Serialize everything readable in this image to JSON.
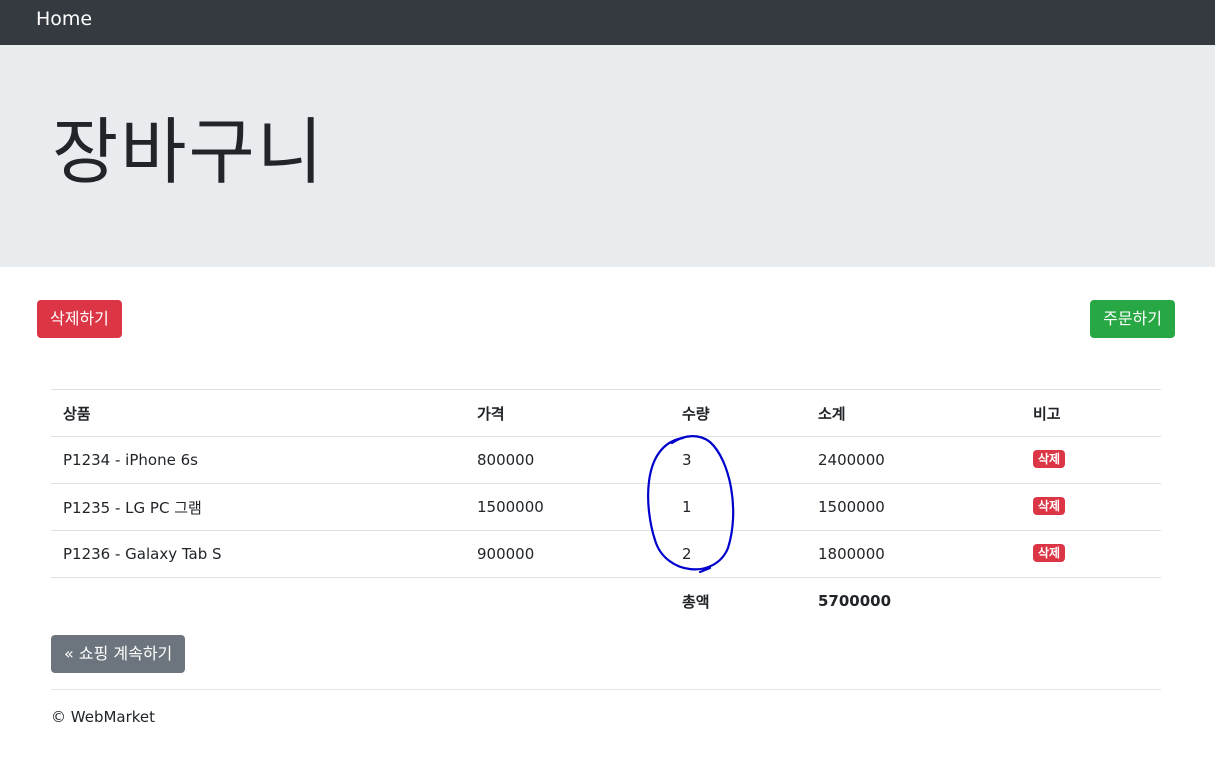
{
  "navbar": {
    "brand": "Home"
  },
  "jumbotron": {
    "title": "장바구니"
  },
  "actions": {
    "delete_label": "삭제하기",
    "order_label": "주문하기"
  },
  "cart": {
    "headers": [
      "상품",
      "가격",
      "수량",
      "소계",
      "비고"
    ],
    "rows": [
      {
        "product": "P1234 - iPhone 6s",
        "price": "800000",
        "quantity": "3",
        "subtotal": "2400000",
        "action": "삭제"
      },
      {
        "product": "P1235 - LG PC 그램",
        "price": "1500000",
        "quantity": "1",
        "subtotal": "1500000",
        "action": "삭제"
      },
      {
        "product": "P1236 - Galaxy Tab S",
        "price": "900000",
        "quantity": "2",
        "subtotal": "1800000",
        "action": "삭제"
      }
    ],
    "total_label": "총액",
    "total_value": "5700000"
  },
  "continue_label": "« 쇼핑 계속하기",
  "footer": {
    "text": "© WebMarket"
  },
  "colors": {
    "danger": "#dc3545",
    "success": "#28a745",
    "secondary": "#6c757d",
    "navbar": "#343a40",
    "jumbotron": "#e9ecef",
    "annotation": "#0000cc"
  }
}
